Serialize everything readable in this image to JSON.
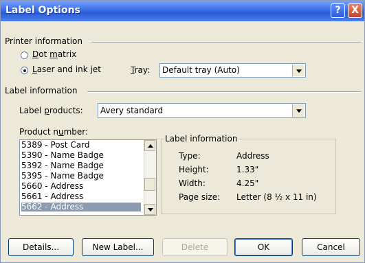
{
  "window": {
    "title": "Label Options"
  },
  "titlebar": {
    "help_glyph": "?",
    "close_glyph": "X"
  },
  "printer_info": {
    "section_label": "Printer information",
    "dot_matrix_label": "Dot matrix",
    "dot_matrix_checked": false,
    "laser_label": "Laser and ink jet",
    "laser_checked": true,
    "tray_label": "Tray:",
    "tray_value": "Default tray (Auto)"
  },
  "label_info_section": {
    "section_label": "Label information",
    "products_label": "Label products:",
    "products_value": "Avery standard"
  },
  "product_number": {
    "label": "Product number:",
    "items": [
      "5389 - Post Card",
      "5390 - Name Badge",
      "5392 - Name Badge",
      "5395 - Name Badge",
      "5660 - Address",
      "5661 - Address",
      "5662 - Address"
    ],
    "selected_index": 6
  },
  "details_group": {
    "title": "Label information",
    "rows": [
      {
        "key": "Type:",
        "value": "Address"
      },
      {
        "key": "Height:",
        "value": "1.33\""
      },
      {
        "key": "Width:",
        "value": "4.25\""
      },
      {
        "key": "Page size:",
        "value": "Letter (8 ½ x 11 in)"
      }
    ]
  },
  "buttons": {
    "details": "Details...",
    "new_label": "New Label...",
    "delete": "Delete",
    "ok": "OK",
    "cancel": "Cancel"
  },
  "icons": [
    "help-icon",
    "close-icon",
    "chevron-down-icon",
    "scroll-up-icon",
    "scroll-down-icon"
  ]
}
